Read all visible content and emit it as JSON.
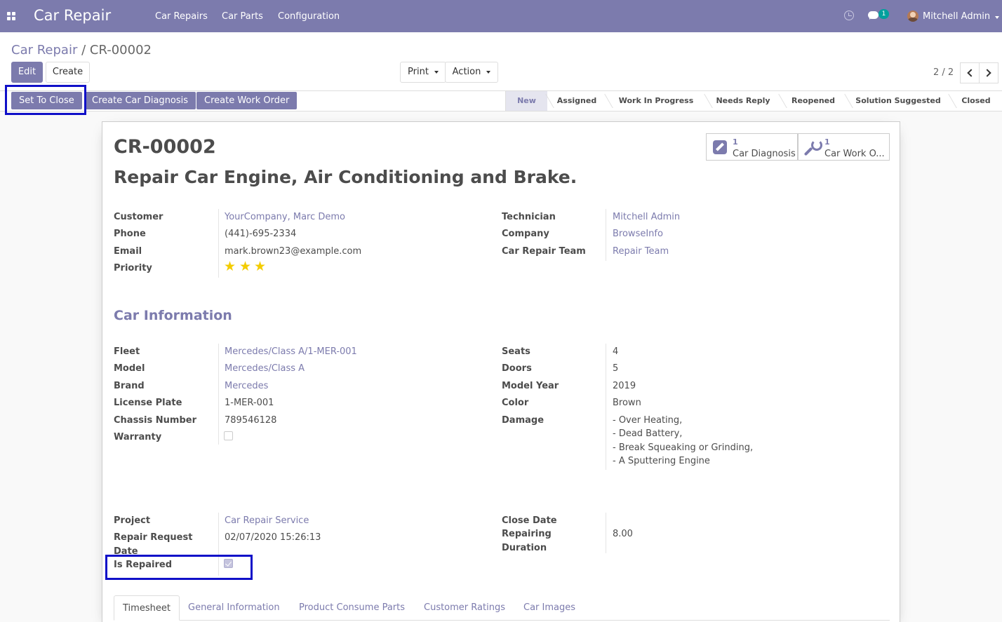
{
  "navbar": {
    "app_name": "Car Repair",
    "menu": [
      "Car Repairs",
      "Car Parts",
      "Configuration"
    ],
    "chat_count": "1",
    "user_name": "Mitchell Admin"
  },
  "breadcrumb": {
    "parent": "Car Repair",
    "separator": " / ",
    "current": "CR-00002"
  },
  "control": {
    "edit_label": "Edit",
    "create_label": "Create",
    "print_label": "Print",
    "action_label": "Action",
    "pager": "2 / 2"
  },
  "statusbar": {
    "buttons": [
      "Set To Close",
      "Create Car Diagnosis",
      "Create Work Order"
    ],
    "stages": [
      "New",
      "Assigned",
      "Work In Progress",
      "Needs Reply",
      "Reopened",
      "Solution Suggested",
      "Closed"
    ],
    "active_stage": "New"
  },
  "smart_buttons": [
    {
      "count": "1",
      "label": "Car Diagnosis",
      "icon": "pencil-square-icon"
    },
    {
      "count": "1",
      "label": "Car Work O...",
      "icon": "wrench-icon"
    }
  ],
  "record": {
    "id": "CR-00002",
    "name": "Repair Car Engine, Air Conditioning and Brake."
  },
  "left_fields": {
    "customer_label": "Customer",
    "customer": "YourCompany, Marc Demo",
    "phone_label": "Phone",
    "phone": "(441)-695-2334",
    "email_label": "Email",
    "email": "mark.brown23@example.com",
    "priority_label": "Priority",
    "priority": 3
  },
  "right_fields": {
    "technician_label": "Technician",
    "technician": "Mitchell Admin",
    "company_label": "Company",
    "company": "BrowseInfo",
    "team_label": "Car Repair Team",
    "team": "Repair Team"
  },
  "car_info": {
    "title": "Car Information",
    "fleet_label": "Fleet",
    "fleet": "Mercedes/Class A/1-MER-001",
    "model_label": "Model",
    "model": "Mercedes/Class A",
    "brand_label": "Brand",
    "brand": "Mercedes",
    "plate_label": "License Plate",
    "plate": "1-MER-001",
    "chassis_label": "Chassis Number",
    "chassis": "789546128",
    "warranty_label": "Warranty",
    "warranty": false,
    "seats_label": "Seats",
    "seats": "4",
    "doors_label": "Doors",
    "doors": "5",
    "year_label": "Model Year",
    "year": "2019",
    "color_label": "Color",
    "color": "Brown",
    "damage_label": "Damage",
    "damage": [
      "- Over Heating,",
      "- Dead Battery,",
      "- Break Squeaking or Grinding,",
      "- A Sputtering Engine"
    ]
  },
  "project_fields": {
    "project_label": "Project",
    "project": "Car Repair Service",
    "request_date_label_1": "Repair Request",
    "request_date_label_2": "Date",
    "request_date": "02/07/2020 15:26:13",
    "is_repaired_label": "Is Repaired",
    "is_repaired": true,
    "close_date_label": "Close Date",
    "duration_label_1": "Repairing",
    "duration_label_2": "Duration",
    "duration": "8.00"
  },
  "tabs": [
    "Timesheet",
    "General Information",
    "Product Consume Parts",
    "Customer Ratings",
    "Car Images"
  ],
  "colors": {
    "primary": "#7c7bad",
    "highlight": "#1010c8",
    "star": "#f3cc00"
  }
}
